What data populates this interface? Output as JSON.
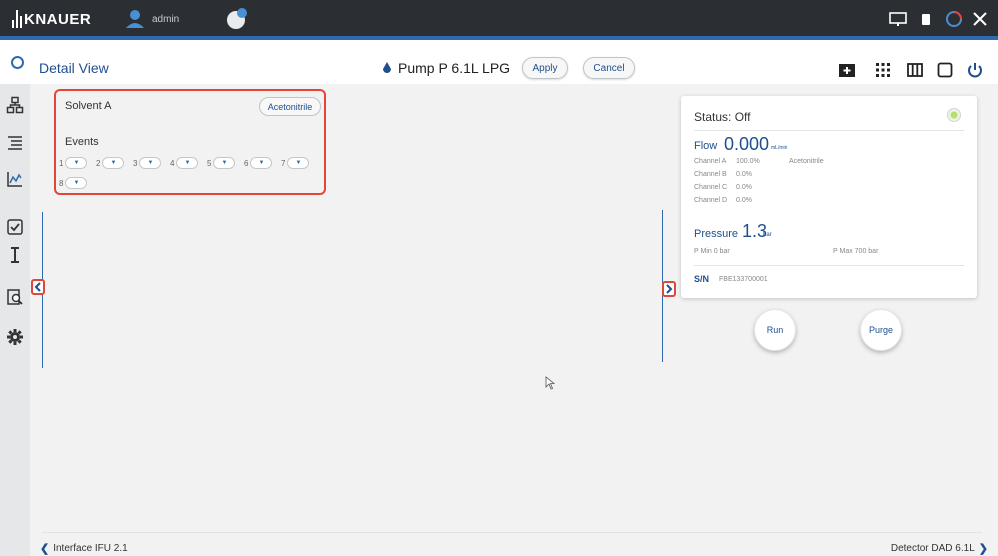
{
  "topbar": {
    "brand": "KNAUER",
    "user": "admin"
  },
  "header": {
    "title": "Detail View",
    "device": "Pump P 6.1L LPG",
    "apply_label": "Apply",
    "cancel_label": "Cancel"
  },
  "solvent": {
    "label": "Solvent A",
    "value": "Acetonitrile"
  },
  "events": {
    "label": "Events",
    "items": [
      "1",
      "2",
      "3",
      "4",
      "5",
      "6",
      "7",
      "8"
    ]
  },
  "status": {
    "title": "Status: Off",
    "flow_label": "Flow",
    "flow_value": "0.000",
    "flow_unit": "mL/min",
    "channels": [
      {
        "name": "Channel A",
        "pct": "100.0%",
        "solvent": "Acetonitrile"
      },
      {
        "name": "Channel B",
        "pct": "0.0%",
        "solvent": ""
      },
      {
        "name": "Channel C",
        "pct": "0.0%",
        "solvent": ""
      },
      {
        "name": "Channel D",
        "pct": "0.0%",
        "solvent": ""
      }
    ],
    "pressure_label": "Pressure",
    "pressure_value": "1.3",
    "pressure_unit": "bar",
    "pmin": "P Min  0 bar",
    "pmax": "P Max  700 bar",
    "sn_label": "S/N",
    "sn_value": "FBE133700001"
  },
  "buttons": {
    "run": "Run",
    "purge": "Purge"
  },
  "footer": {
    "left": "Interface IFU 2.1",
    "right": "Detector DAD 6.1L"
  },
  "colors": {
    "topbar": "#2b2f33",
    "accent": "#2f6ab0",
    "highlight": "#e0463a",
    "background": "#f2f2f2"
  }
}
